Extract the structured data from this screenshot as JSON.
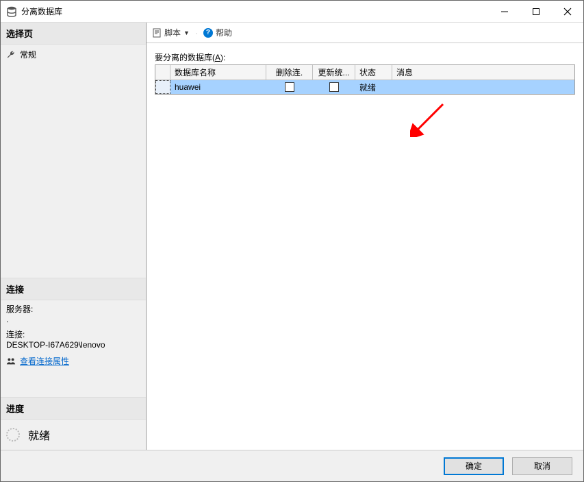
{
  "window": {
    "title": "分离数据库"
  },
  "sidebar": {
    "select_page_header": "选择页",
    "general_link": "常规",
    "connection_header": "连接",
    "server_label": "服务器:",
    "server_value": ".",
    "connection_label": "连接:",
    "connection_value": "DESKTOP-I67A629\\lenovo",
    "view_props_link": "查看连接属性",
    "progress_header": "进度",
    "progress_status": "就绪"
  },
  "toolbar": {
    "script_label": "脚本",
    "help_label": "帮助"
  },
  "main": {
    "section_label_pre": "要分离的数据库(",
    "section_label_key": "A",
    "section_label_post": "):",
    "columns": {
      "name": "数据库名称",
      "delete_conn": "删除连.",
      "update_stat": "更新统...",
      "status": "状态",
      "message": "消息"
    },
    "rows": [
      {
        "name": "huawei",
        "status": "就绪"
      }
    ]
  },
  "footer": {
    "ok": "确定",
    "cancel": "取消"
  }
}
